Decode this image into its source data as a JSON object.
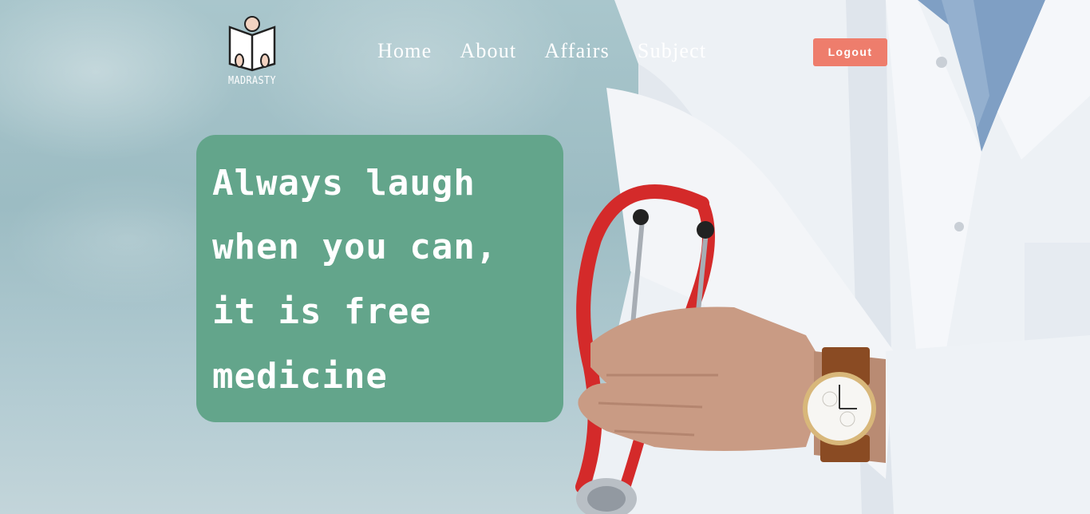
{
  "brand": {
    "logo_text": "MADRASTY",
    "icon": "reading-figure-logo"
  },
  "nav": {
    "items": [
      {
        "label": "Home"
      },
      {
        "label": "About"
      },
      {
        "label": "Affairs"
      },
      {
        "label": "Subject"
      }
    ],
    "logout_label": "Logout"
  },
  "hero": {
    "quote_lines": [
      "Always laugh",
      "when you can,",
      "it is free",
      "medicine"
    ],
    "image": "doctor-with-stethoscope-photo"
  },
  "colors": {
    "card": "#63a58b",
    "logout_button": "#ee7d6c",
    "nav_text": "#ffffff"
  }
}
